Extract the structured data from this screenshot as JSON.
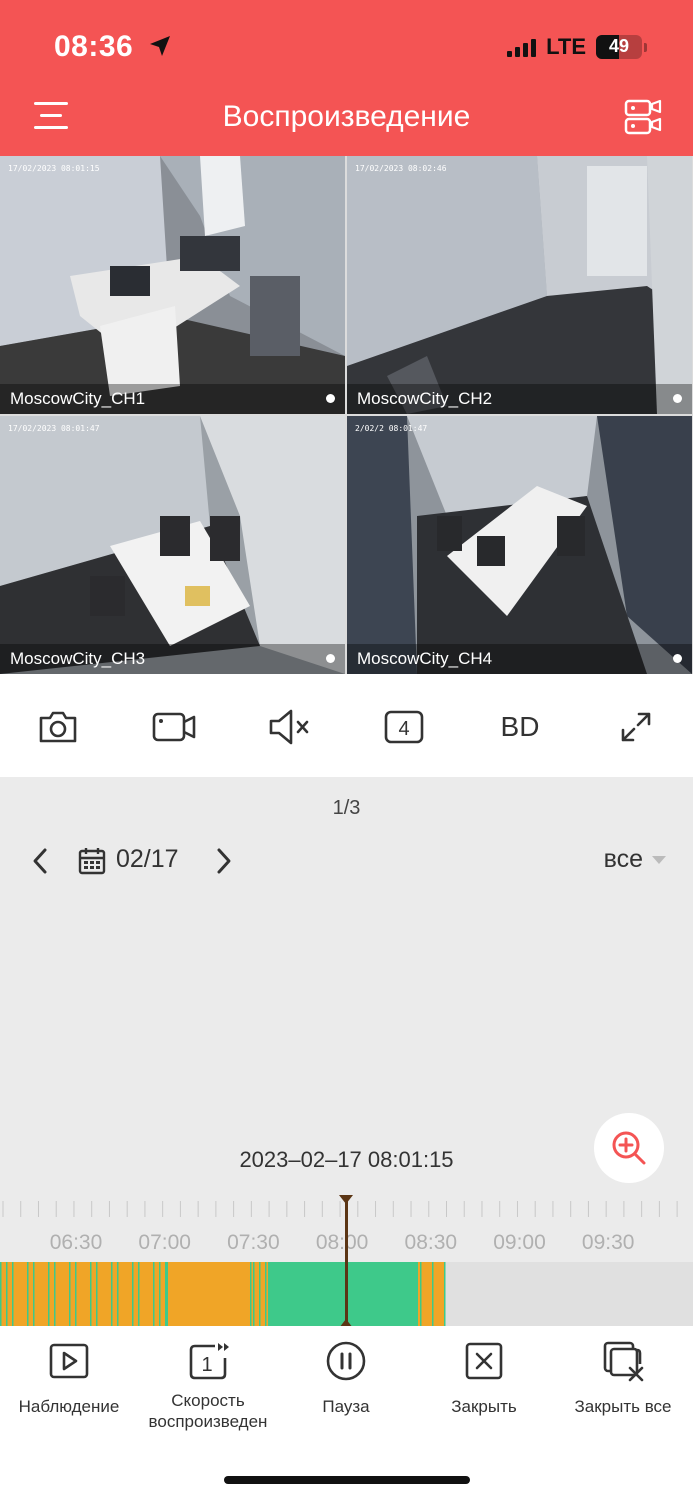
{
  "status_bar": {
    "time": "08:36",
    "network": "LTE",
    "battery": "49"
  },
  "header": {
    "title": "Воспроизведение"
  },
  "cameras": [
    {
      "name": "MoscowCity_CH1",
      "osd": "17/02/2023 08:01:15",
      "selected": true
    },
    {
      "name": "MoscowCity_CH2",
      "osd": "17/02/2023 08:02:46",
      "selected": false
    },
    {
      "name": "MoscowCity_CH3",
      "osd": "17/02/2023 08:01:47",
      "selected": false
    },
    {
      "name": "MoscowCity_CH4",
      "osd": "2/02/2  08:01:47",
      "selected": false
    }
  ],
  "toolbar": {
    "icons": [
      "camera-icon",
      "video-record-icon",
      "mute-icon",
      "split-4-icon",
      "quality-bd",
      "fullscreen-icon"
    ],
    "split_count": "4",
    "quality_label": "BD"
  },
  "playback": {
    "pager": "1/3",
    "date": "02/17",
    "filter": "все",
    "timestamp": "2023–02–17 08:01:15",
    "tick_labels": [
      "06:30",
      "07:00",
      "07:30",
      "08:00",
      "08:30",
      "09:00",
      "09:30"
    ],
    "colors": {
      "alarm": "#f0a527",
      "regular": "#3ec98a",
      "cursor": "#5b3514",
      "accent": "#f45454"
    }
  },
  "bottom_nav": [
    {
      "label": "Наблюдение",
      "icon": "play-icon"
    },
    {
      "label": "Скорость воспроизведен",
      "icon": "speed-icon",
      "value": "1"
    },
    {
      "label": "Пауза",
      "icon": "pause-icon"
    },
    {
      "label": "Закрыть",
      "icon": "close-icon"
    },
    {
      "label": "Закрыть все",
      "icon": "close-all-icon"
    }
  ]
}
